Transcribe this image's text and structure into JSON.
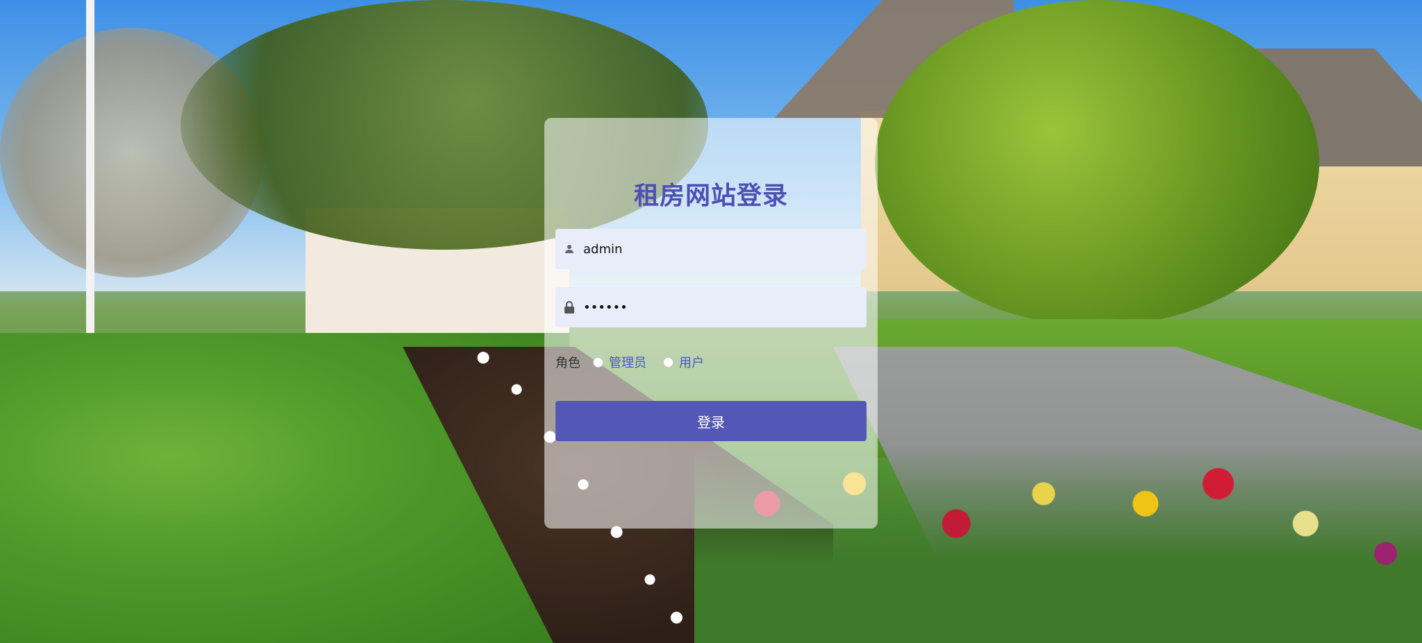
{
  "page": {
    "title": "租房网站登录"
  },
  "form": {
    "username_value": "admin",
    "password_value": "••••••",
    "role_label": "角色",
    "role_options": [
      "管理员",
      "用户"
    ],
    "submit_label": "登录"
  },
  "icons": {
    "username": "user-icon",
    "password": "lock-icon"
  },
  "colors": {
    "title": "#4c4fb3",
    "button": "#5357b5",
    "input_bg": "#e8edf9",
    "radio_text": "#4a55c7"
  }
}
